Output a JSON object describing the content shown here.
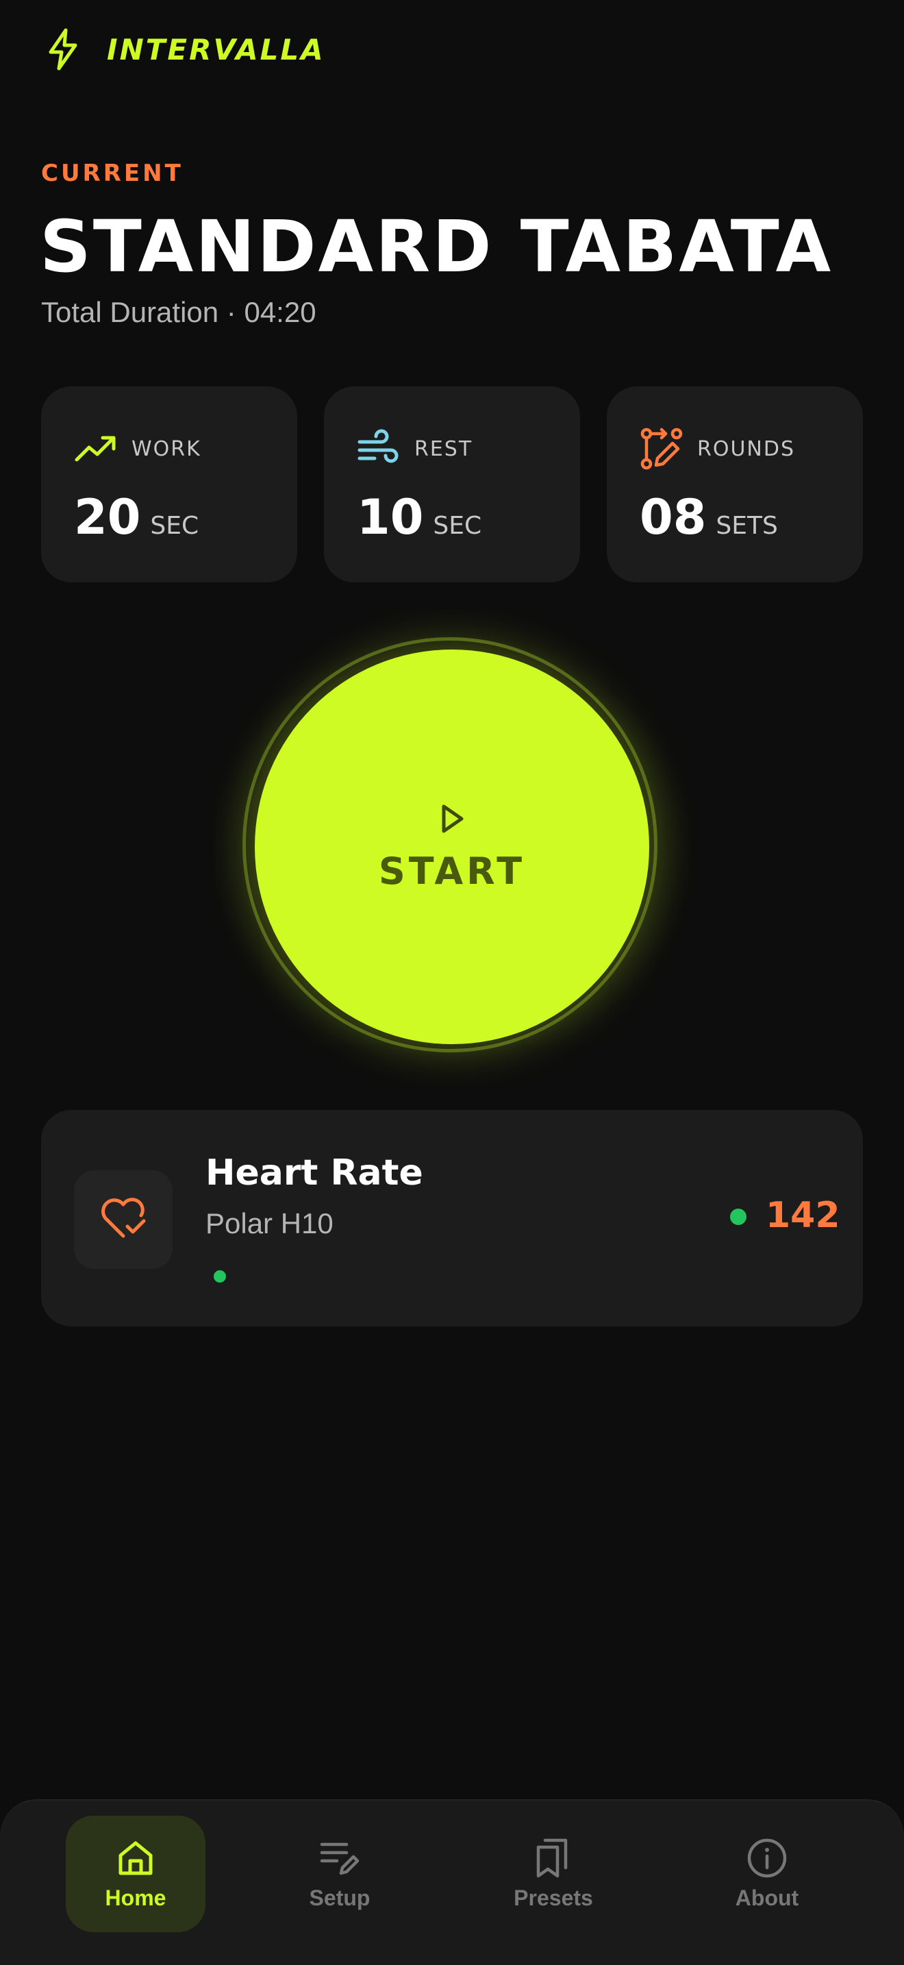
{
  "app": {
    "name": "INTERVALLA",
    "logo_icon": "lightning-bolt-icon"
  },
  "workout": {
    "current_label": "CURRENT",
    "title": "STANDARD TABATA",
    "total_duration": "Total Duration · 04:20"
  },
  "stats": [
    {
      "label": "WORK",
      "value": "20",
      "unit": "SEC",
      "icon": "trending-up-icon",
      "color": "#cdfb23"
    },
    {
      "label": "REST",
      "value": "10",
      "unit": "SEC",
      "icon": "wind-icon",
      "color": "#7dd3e8"
    },
    {
      "label": "ROUNDS",
      "value": "08",
      "unit": "SETS",
      "icon": "route-edit-icon",
      "color": "#ff7a3d"
    }
  ],
  "start": {
    "label": "START",
    "icon": "play-icon"
  },
  "heart_rate": {
    "title": "Heart Rate",
    "device": "Polar H10",
    "bpm": "142",
    "icon": "heart-check-icon",
    "status_color": "#22c55e"
  },
  "nav": {
    "items": [
      {
        "label": "Home",
        "icon": "home-icon",
        "active": true
      },
      {
        "label": "Setup",
        "icon": "list-edit-icon",
        "active": false
      },
      {
        "label": "Presets",
        "icon": "bookmarks-icon",
        "active": false
      },
      {
        "label": "About",
        "icon": "info-icon",
        "active": false
      }
    ]
  },
  "colors": {
    "accent": "#cdfb23",
    "secondary": "#ff7a3d",
    "background": "#0d0d0d",
    "card": "#1c1c1c"
  }
}
